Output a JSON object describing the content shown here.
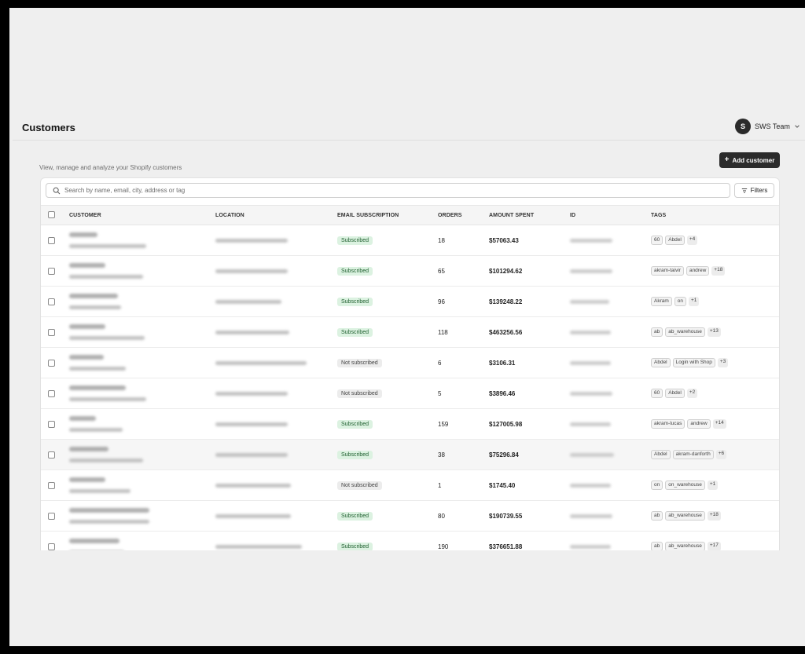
{
  "header": {
    "title": "Customers",
    "team": {
      "avatar_letter": "S",
      "name": "SWS Team"
    }
  },
  "subtitle": "View, manage and analyze your Shopify customers",
  "add_button": {
    "plus": "+",
    "label": "Add customer"
  },
  "search": {
    "placeholder": "Search by name, email, city, address or tag"
  },
  "filters_label": "Filters",
  "columns": [
    "CUSTOMER",
    "LOCATION",
    "EMAIL SUBSCRIPTION",
    "ORDERS",
    "AMOUNT SPENT",
    "ID",
    "TAGS"
  ],
  "rows": [
    {
      "subscription": "Subscribed",
      "orders": "18",
      "amount": "$57063.43",
      "tags": [
        "60",
        "Abdel"
      ],
      "more": "+4"
    },
    {
      "subscription": "Subscribed",
      "orders": "65",
      "amount": "$101294.62",
      "tags": [
        "akram-taivir",
        "andrew"
      ],
      "more": "+18"
    },
    {
      "subscription": "Subscribed",
      "orders": "96",
      "amount": "$139248.22",
      "tags": [
        "Akram",
        "on"
      ],
      "more": "+1"
    },
    {
      "subscription": "Subscribed",
      "orders": "118",
      "amount": "$463256.56",
      "tags": [
        "ab",
        "ab_warehouse"
      ],
      "more": "+13"
    },
    {
      "subscription": "Not subscribed",
      "orders": "6",
      "amount": "$3106.31",
      "tags": [
        "Abdel",
        "Login with Shop"
      ],
      "more": "+3"
    },
    {
      "subscription": "Not subscribed",
      "orders": "5",
      "amount": "$3896.46",
      "tags": [
        "60",
        "Abdel"
      ],
      "more": "+2"
    },
    {
      "subscription": "Subscribed",
      "orders": "159",
      "amount": "$127005.98",
      "tags": [
        "akram-lucas",
        "andrew"
      ],
      "more": "+14"
    },
    {
      "subscription": "Subscribed",
      "orders": "38",
      "amount": "$75296.84",
      "tags": [
        "Abdel",
        "akram-danforth"
      ],
      "more": "+6"
    },
    {
      "subscription": "Not subscribed",
      "orders": "1",
      "amount": "$1745.40",
      "tags": [
        "on",
        "on_warehouse"
      ],
      "more": "+1"
    },
    {
      "subscription": "Subscribed",
      "orders": "80",
      "amount": "$190739.55",
      "tags": [
        "ab",
        "ab_warehouse"
      ],
      "more": "+18"
    },
    {
      "subscription": "Subscribed",
      "orders": "190",
      "amount": "$376651.88",
      "tags": [
        "ab",
        "ab_warehouse"
      ],
      "more": "+17"
    }
  ],
  "colors": {
    "subscribed_bg": "#dcf2e1",
    "subscribed_text": "#1d5e2d",
    "primary_button": "#2b2b2b"
  }
}
